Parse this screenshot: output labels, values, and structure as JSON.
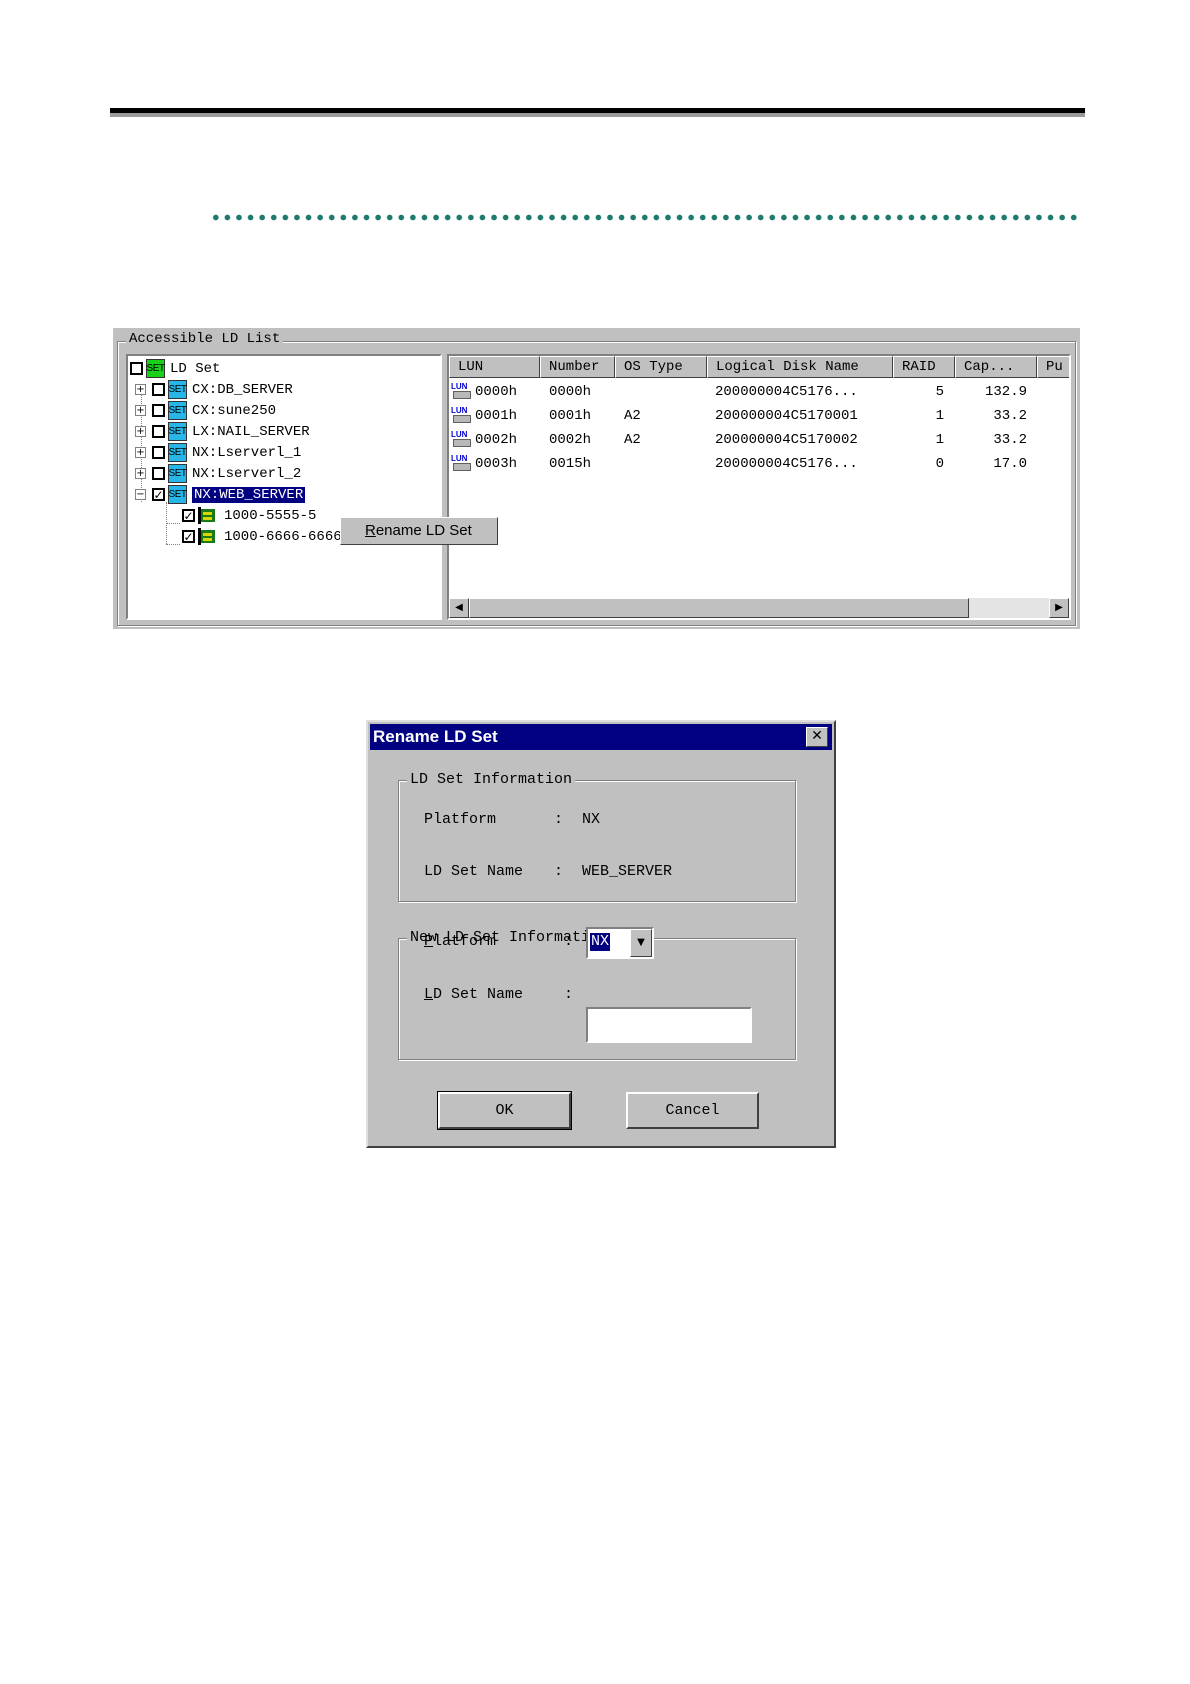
{
  "panel": {
    "group_title": "Accessible LD List",
    "tree": {
      "root": {
        "icon": "set-icon-green",
        "label": "LD Set"
      },
      "items": [
        {
          "label": "CX:DB_SERVER",
          "checked": false,
          "expand": "+"
        },
        {
          "label": "CX:sune250",
          "checked": false,
          "expand": "+"
        },
        {
          "label": "LX:NAIL_SERVER",
          "checked": false,
          "expand": "+"
        },
        {
          "label": "NX:Lserverl_1",
          "checked": false,
          "expand": "+"
        },
        {
          "label": "NX:Lserverl_2",
          "checked": false,
          "expand": "+"
        },
        {
          "label": "NX:WEB_SERVER",
          "checked": true,
          "expand": "−",
          "selected": true
        }
      ],
      "children": [
        {
          "label": "1000-5555-5",
          "checked": true,
          "icon": "hba-icon"
        },
        {
          "label": "1000-6666-6666-6666",
          "checked": true,
          "icon": "hba-icon"
        }
      ],
      "set_icon_text": "SET",
      "checkmark": "✓"
    },
    "context_menu": {
      "prefix": "R",
      "rest": "ename LD Set"
    },
    "list": {
      "columns": [
        "LUN",
        "Number",
        "OS Type",
        "Logical Disk Name",
        "RAID",
        "Cap...",
        "Pu"
      ],
      "lun_icon_text": "LUN",
      "rows": [
        {
          "lun": "0000h",
          "number": "0000h",
          "os_type": "",
          "name": "200000004C5176...",
          "raid": "5",
          "cap": "132.9"
        },
        {
          "lun": "0001h",
          "number": "0001h",
          "os_type": "A2",
          "name": "200000004C5170001",
          "raid": "1",
          "cap": "33.2"
        },
        {
          "lun": "0002h",
          "number": "0002h",
          "os_type": "A2",
          "name": "200000004C5170002",
          "raid": "1",
          "cap": "33.2"
        },
        {
          "lun": "0003h",
          "number": "0015h",
          "os_type": "",
          "name": "200000004C5176...",
          "raid": "0",
          "cap": "17.0"
        }
      ],
      "scroll_left": "◀",
      "scroll_right": "▶"
    }
  },
  "dialog": {
    "title": "Rename LD Set",
    "close": "✕",
    "info_group": {
      "title": "LD Set Information",
      "platform_label": "Platform",
      "platform_value": "NX",
      "name_label": "LD Set Name",
      "name_value": "WEB_SERVER",
      "colon": ":"
    },
    "new_group": {
      "title": "New LD Set Information",
      "platform_label_u": "P",
      "platform_label_rest": "latform",
      "name_label_u": "L",
      "name_label_rest": "D Set Name",
      "colon": ":",
      "platform_selected": "NX",
      "name_value": "",
      "dropdown_arrow": "▼"
    },
    "ok_label": "OK",
    "cancel_label": "Cancel"
  },
  "colors": {
    "selection": "#000080",
    "set_green": "#17d217",
    "set_cyan": "#28b6e8",
    "divider_dots": "#1f7a6e"
  }
}
